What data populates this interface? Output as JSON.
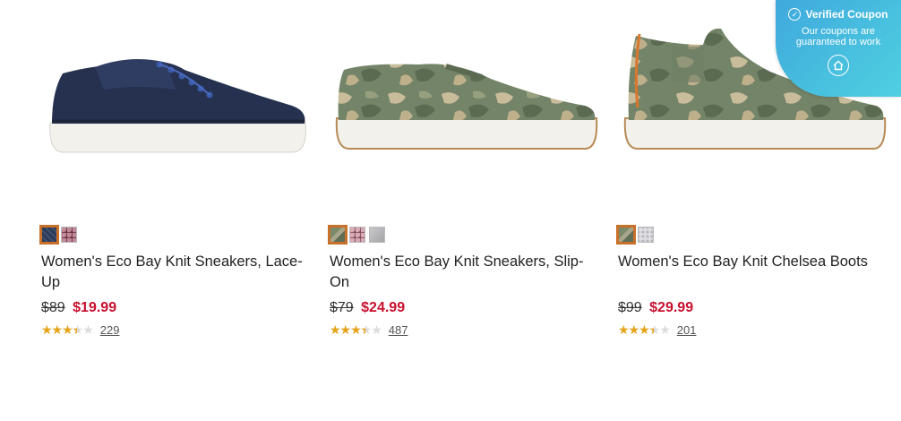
{
  "products": [
    {
      "name": "Women's Eco Bay Knit Sneakers, Lace-Up",
      "was_price": "$89",
      "sale_price": "$19.99",
      "rating": 3.5,
      "review_count": "229",
      "swatches": [
        {
          "color": "#2b3a55",
          "pattern": "knit-navy",
          "selected": true
        },
        {
          "color": "#7a3b4b",
          "pattern": "floral",
          "selected": false
        }
      ],
      "image_icon": "navy-lace-up-sneaker"
    },
    {
      "name": "Women's Eco Bay Knit Sneakers, Slip-On",
      "was_price": "$79",
      "sale_price": "$24.99",
      "rating": 3.5,
      "review_count": "487",
      "swatches": [
        {
          "color": "#7a8a6a",
          "pattern": "camo",
          "selected": true
        },
        {
          "color": "#8a5a66",
          "pattern": "floral",
          "selected": false
        },
        {
          "color": "#b5b5b8",
          "pattern": "grey-knit",
          "selected": false
        }
      ],
      "image_icon": "camo-slip-on-sneaker"
    },
    {
      "name": "Women's Eco Bay Knit Chelsea Boots",
      "was_price": "$99",
      "sale_price": "$29.99",
      "rating": 3.5,
      "review_count": "201",
      "swatches": [
        {
          "color": "#7a8a6a",
          "pattern": "camo",
          "selected": true
        },
        {
          "color": "#c8c8cc",
          "pattern": "grey-knit",
          "selected": false
        }
      ],
      "image_icon": "camo-chelsea-boot"
    }
  ],
  "coupon_badge": {
    "title": "Verified Coupon",
    "subtitle": "Our coupons are guaranteed to work",
    "icon": "home-icon"
  },
  "colors": {
    "sale_red": "#c8102e",
    "star_gold": "#e8a317",
    "selected_outline": "#c9712a",
    "badge_blue": "#3fa9dd"
  }
}
